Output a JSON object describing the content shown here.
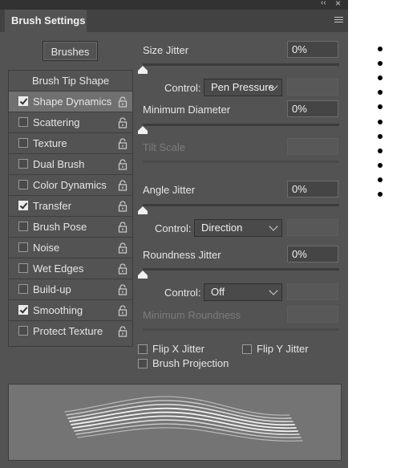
{
  "panel": {
    "title": "Brush Settings",
    "brushes_button": "Brushes"
  },
  "sidebar": {
    "header": "Brush Tip Shape",
    "items": [
      {
        "label": "Shape Dynamics",
        "checked": true,
        "selected": true
      },
      {
        "label": "Scattering",
        "checked": false
      },
      {
        "label": "Texture",
        "checked": false
      },
      {
        "label": "Dual Brush",
        "checked": false
      },
      {
        "label": "Color Dynamics",
        "checked": false
      },
      {
        "label": "Transfer",
        "checked": true
      },
      {
        "label": "Brush Pose",
        "checked": false
      },
      {
        "label": "Noise",
        "checked": false
      },
      {
        "label": "Wet Edges",
        "checked": false
      },
      {
        "label": "Build-up",
        "checked": false
      },
      {
        "label": "Smoothing",
        "checked": true
      },
      {
        "label": "Protect Texture",
        "checked": false
      }
    ]
  },
  "settings": {
    "size_jitter": {
      "label": "Size Jitter",
      "value": "0%"
    },
    "size_control": {
      "label": "Control:",
      "value": "Pen Pressure"
    },
    "min_diameter": {
      "label": "Minimum Diameter",
      "value": "0%"
    },
    "tilt_scale": {
      "label": "Tilt Scale",
      "value": ""
    },
    "angle_jitter": {
      "label": "Angle Jitter",
      "value": "0%"
    },
    "angle_control": {
      "label": "Control:",
      "value": "Direction"
    },
    "roundness_jitter": {
      "label": "Roundness Jitter",
      "value": "0%"
    },
    "roundness_control": {
      "label": "Control:",
      "value": "Off"
    },
    "min_roundness": {
      "label": "Minimum Roundness",
      "value": ""
    }
  },
  "options": {
    "flip_x": "Flip X Jitter",
    "flip_y": "Flip Y Jitter",
    "projection": "Brush Projection"
  }
}
